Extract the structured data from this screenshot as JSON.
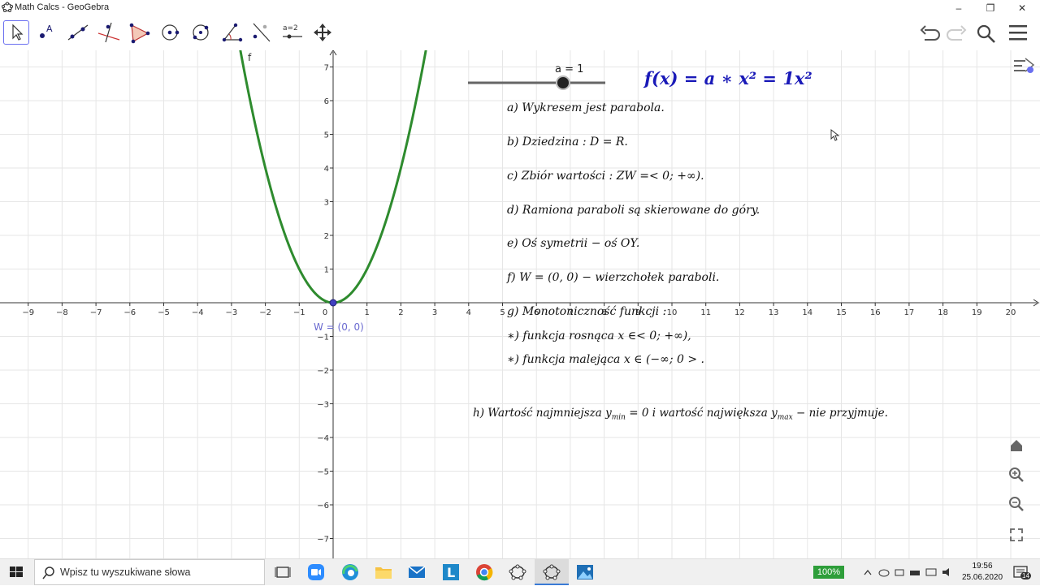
{
  "window": {
    "title": "Math Calcs - GeoGebra",
    "minimize": "–",
    "restore": "❐",
    "close": "✕"
  },
  "toolbar": {
    "tools": [
      {
        "name": "move-tool"
      },
      {
        "name": "point-tool"
      },
      {
        "name": "line-tool"
      },
      {
        "name": "perpendicular-line-tool"
      },
      {
        "name": "polygon-tool"
      },
      {
        "name": "circle-center-point-tool"
      },
      {
        "name": "circle-three-points-tool"
      },
      {
        "name": "angle-tool"
      },
      {
        "name": "reflect-tool"
      },
      {
        "name": "slider-tool"
      },
      {
        "name": "move-graphics-view-tool"
      }
    ],
    "slider_tool_label": "a=2"
  },
  "graphics": {
    "x_ticks": [
      "−9",
      "−8",
      "−7",
      "−6",
      "−5",
      "−4",
      "−3",
      "−2",
      "−1",
      "0",
      "1",
      "2",
      "3",
      "4",
      "5",
      "6",
      "7",
      "8",
      "9",
      "10",
      "11",
      "12",
      "13",
      "14",
      "15",
      "16",
      "17",
      "18",
      "19",
      "20"
    ],
    "y_ticks_pos": [
      "1",
      "2",
      "3",
      "4",
      "5",
      "6",
      "7"
    ],
    "y_ticks_neg": [
      "−1",
      "−2",
      "−3",
      "−4",
      "−5",
      "−6",
      "−7"
    ],
    "curve_label": "f",
    "vertex_label": "W = (0, 0)",
    "slider_label": "a = 1",
    "slider_value": 1,
    "formula": "f(x) = a ∗ x² = 1x²",
    "lines": {
      "a": "a) Wykresem jest parabola.",
      "b": "b) Dziedzina :  D = R.",
      "c": "c) Zbiór wartości :  ZW =< 0; +∞).",
      "d": "d) Ramiona paraboli są skierowane do góry.",
      "e": "e) Oś symetrii  −  oś OY.",
      "f": "f) W = (0, 0)  −  wierzchołek paraboli.",
      "g": "g) Monotoniczność funkcji :",
      "g1": "∗) funkcja rosnąca x ∈< 0; +∞),",
      "g2": "∗) funkcja malejąca x ∈ (−∞; 0 > .",
      "h_pre": "h) Wartość najmniejsza y",
      "h_sub1": "min",
      "h_mid": " = 0 i wartość największa y",
      "h_sub2": "max",
      "h_post": "  −  nie przyjmuje."
    }
  },
  "colors": {
    "curve": "#2e8b2e",
    "formula": "#1a1ab8",
    "vertex": "#4040c0",
    "vertex_label": "#6a6ad0",
    "grid": "#e6e6e6"
  },
  "taskbar": {
    "search_placeholder": "Wpisz tu wyszukiwane słowa",
    "battery": "100%",
    "time": "19:56",
    "date": "25.06.2020",
    "notifications": "14"
  }
}
